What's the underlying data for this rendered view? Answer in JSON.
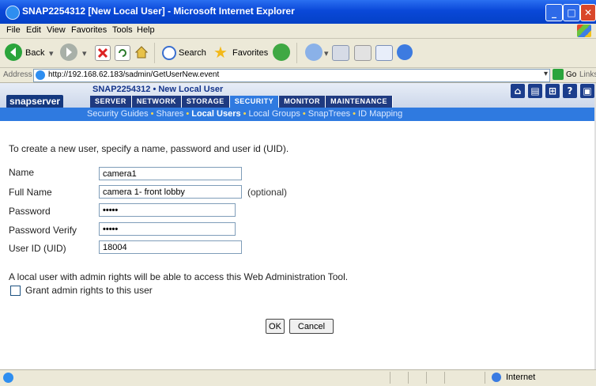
{
  "window": {
    "title": "SNAP2254312 [New Local User] - Microsoft Internet Explorer"
  },
  "menu": [
    "File",
    "Edit",
    "View",
    "Favorites",
    "Tools",
    "Help"
  ],
  "toolbar": {
    "back": "Back",
    "search": "Search",
    "favorites": "Favorites"
  },
  "address": {
    "label": "Address",
    "url": "http://192.168.62.183/sadmin/GetUserNew.event",
    "go": "Go",
    "links": "Links"
  },
  "header": {
    "logo": "snapserver",
    "page_title": "SNAP2254312 • New Local User",
    "tabs": [
      "SERVER",
      "NETWORK",
      "STORAGE",
      "SECURITY",
      "MONITOR",
      "MAINTENANCE"
    ],
    "active_tab": "SECURITY",
    "icons": [
      "home-icon",
      "server-icon",
      "network-icon",
      "help-icon",
      "save-icon"
    ]
  },
  "subnav": [
    "Security Guides",
    "Shares",
    "Local Users",
    "Local Groups",
    "SnapTrees",
    "ID Mapping"
  ],
  "subnav_active": "Local Users",
  "form": {
    "intro": "To create a new user, specify a name, password and user id (UID).",
    "fields": [
      {
        "label": "Name",
        "value": "camera1"
      },
      {
        "label": "Full Name",
        "value": "camera 1- front lobby",
        "hint": "(optional)"
      },
      {
        "label": "Password",
        "value": "•••••"
      },
      {
        "label": "Password Verify",
        "value": "•••••"
      },
      {
        "label": "User ID (UID)",
        "value": "18004"
      }
    ],
    "admin_note": "A local user with admin rights will be able to access this Web Administration Tool.",
    "grant_label": "Grant admin rights to this user",
    "grant_checked": false,
    "ok": "OK",
    "cancel": "Cancel"
  },
  "status": {
    "zone": "Internet"
  },
  "colors": {
    "title_bar": "#0a48d8",
    "nav_dark": "#1f3a80",
    "nav_active": "#2f7ae0",
    "subnav_sep": "#ffd94d"
  }
}
